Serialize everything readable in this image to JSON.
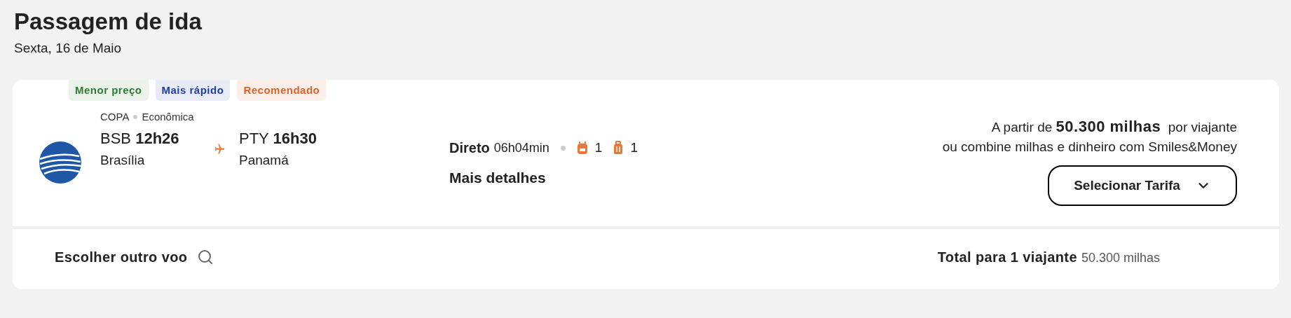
{
  "header": {
    "title": "Passagem de ida",
    "date": "Sexta, 16 de Maio"
  },
  "flight": {
    "tags": [
      {
        "label": "Menor preço",
        "color": "#2e7d32"
      },
      {
        "label": "Mais rápido",
        "color": "#1e3fa8"
      },
      {
        "label": "Recomendado",
        "color": "#e0622a"
      }
    ],
    "airline": "COPA",
    "cabin": "Econômica",
    "departure": {
      "code": "BSB",
      "time": "12h26",
      "city": "Brasília"
    },
    "arrival": {
      "code": "PTY",
      "time": "16h30",
      "city": "Panamá"
    },
    "stop_type": "Direto",
    "duration": "06h04min",
    "baggage": [
      {
        "kind": "backpack",
        "count": "1"
      },
      {
        "kind": "suitcase",
        "count": "1"
      }
    ],
    "details_link": "Mais detalhes",
    "price": "A partir de **50.300 milhas**  por viajante",
    "combine": "ou combine milhas e dinheiro com Smiles&Money",
    "select_button": "Selecionar Tarifa"
  },
  "footer": {
    "other_flight": "Escolher outro voo",
    "total_label": "Total para 1 viajante",
    "total_value": "50.300 milhas"
  }
}
